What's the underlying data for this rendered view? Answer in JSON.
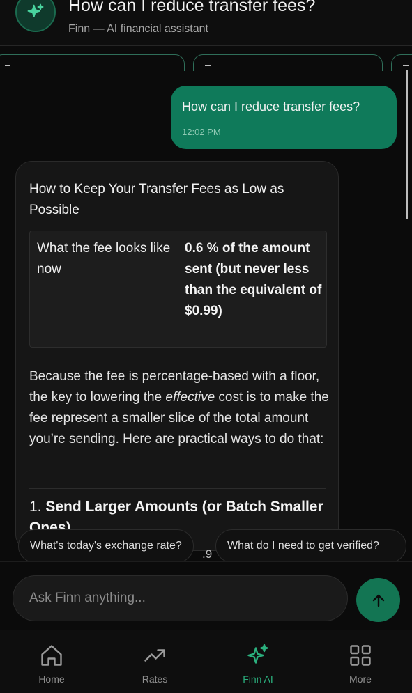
{
  "header": {
    "title": "How can I reduce transfer fees?",
    "subtitle": "Finn — AI financial assistant"
  },
  "conversation": {
    "user_message": {
      "text": "How can I reduce transfer fees?",
      "time": "12:02 PM"
    },
    "assistant_message": {
      "heading": "How to Keep Your Transfer Fees as Low as Possible",
      "table": {
        "label": "What the fee looks like now",
        "value": "0.6 % of the amount sent (but never less than the equivalent of $0.99)"
      },
      "paragraph_before": "Because the fee is percentage-based with a floor, the key to lowering the ",
      "paragraph_emphasis": "effective",
      "paragraph_after": " cost is to make the fee represent a smaller slice of the total amount you’re sending. Here are practical ways to do that:",
      "section_number": "1.",
      "section_title": "Send Larger Amounts (or Batch Smaller Ones)"
    }
  },
  "suggestions": [
    "What's today's exchange rate?",
    "What do I need to get verified?"
  ],
  "peek_text": ".9",
  "composer": {
    "placeholder": "Ask Finn anything..."
  },
  "nav": {
    "items": [
      {
        "label": "Home",
        "icon": "home-icon"
      },
      {
        "label": "Rates",
        "icon": "trending-up-icon"
      },
      {
        "label": "Finn AI",
        "icon": "sparkles-icon",
        "active": true
      },
      {
        "label": "More",
        "icon": "grid-icon"
      }
    ]
  },
  "colors": {
    "accent": "#137553",
    "user_bubble": "#0f7a5a",
    "active_nav": "#2bb07e",
    "background": "#0b0b0b"
  }
}
